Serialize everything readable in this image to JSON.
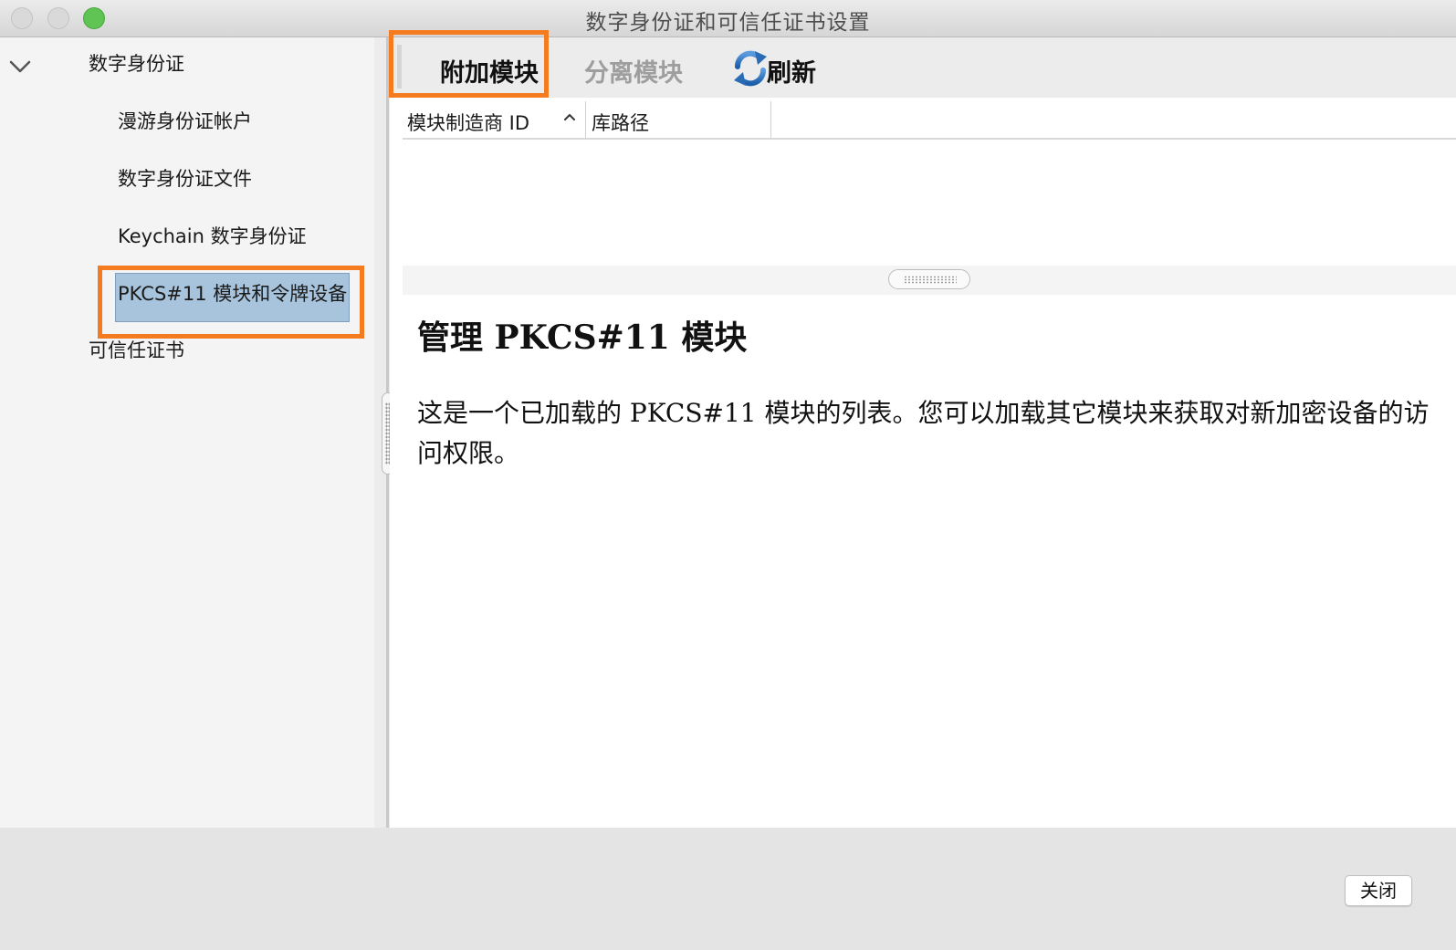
{
  "window": {
    "title": "数字身份证和可信任证书设置"
  },
  "sidebar": {
    "group_label": "数字身份证",
    "items": [
      {
        "label": "漫游身份证帐户"
      },
      {
        "label": "数字身份证文件"
      },
      {
        "label": "Keychain 数字身份证"
      },
      {
        "label": "PKCS#11 模块和令牌设备",
        "selected": true
      }
    ],
    "trusted_label": "可信任证书"
  },
  "toolbar": {
    "attach_label": "附加模块",
    "detach_label": "分离模块",
    "refresh_label": "刷新",
    "refresh_icon": "refresh-icon"
  },
  "table": {
    "columns": [
      {
        "label": "模块制造商 ID",
        "sort": "ascending"
      },
      {
        "label": "库路径"
      }
    ],
    "rows": []
  },
  "description": {
    "heading": "管理 PKCS#11 模块",
    "body": "这是一个已加载的 PKCS#11 模块的列表。您可以加载其它模块来获取对新加密设备的访问权限。"
  },
  "footer": {
    "close_label": "关闭"
  },
  "colors": {
    "highlight": "#f47b20",
    "selection": "#a7c4dc",
    "zoom_button": "#5fc453"
  }
}
